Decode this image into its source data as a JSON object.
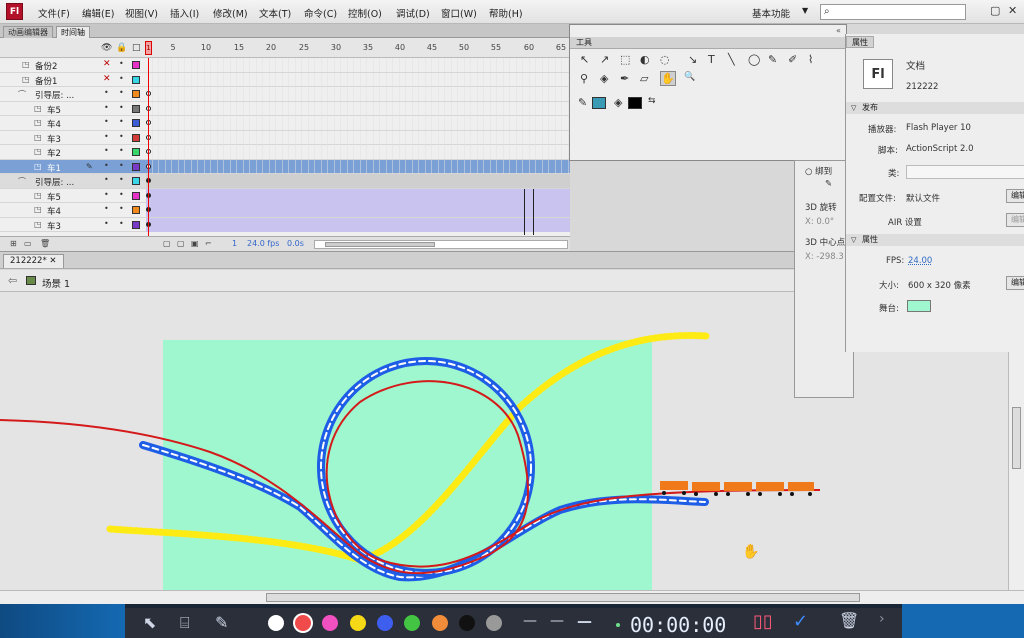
{
  "app": {
    "logo": "Fl"
  },
  "menu": [
    "文件(F)",
    "编辑(E)",
    "视图(V)",
    "插入(I)",
    "修改(M)",
    "文本(T)",
    "命令(C)",
    "控制(O)",
    "调试(D)",
    "窗口(W)",
    "帮助(H)"
  ],
  "workspace": {
    "label": "基本功能",
    "arrow": "▼"
  },
  "search": {
    "icon": "⌕",
    "placeholder": ""
  },
  "window_buttons": [
    "▢",
    "✕"
  ],
  "tabs": {
    "motion_editor": "动画编辑器",
    "timeline": "时间轴"
  },
  "timeline": {
    "frame_numbers": [
      "5",
      "10",
      "15",
      "20",
      "25",
      "30",
      "35",
      "40",
      "45",
      "50",
      "55",
      "60",
      "65"
    ],
    "playhead": "1",
    "header_icons": [
      "eye-icon",
      "lock-icon",
      "outline-icon"
    ],
    "layers": [
      {
        "name": "备份2",
        "color": "#e632c8"
      },
      {
        "name": "备份1",
        "color": "#38d6e6"
      },
      {
        "name": "引导层: ...",
        "color": "#f08a1e",
        "guide": true
      },
      {
        "name": "车5",
        "color": "#777777"
      },
      {
        "name": "车4",
        "color": "#3c5cd6"
      },
      {
        "name": "车3",
        "color": "#d43a3a"
      },
      {
        "name": "车2",
        "color": "#38d66a"
      },
      {
        "name": "车1",
        "color": "#7a3ac8",
        "selected": true
      },
      {
        "name": "引导层: ...",
        "color": "#38d6e6",
        "guide": true
      },
      {
        "name": "车5",
        "color": "#e632c8"
      },
      {
        "name": "车4",
        "color": "#f08a1e"
      },
      {
        "name": "车3",
        "color": "#7a3ac8"
      }
    ],
    "footer": {
      "fps": "24.0 fps",
      "time": "0.0s",
      "frame": "1"
    }
  },
  "document": {
    "tab": "212222*",
    "close": "✕",
    "scene": "场景 1"
  },
  "tools_panel": {
    "title": "工具",
    "tools_row1": [
      "↖",
      "↗",
      "⬚",
      "◐",
      "◌",
      "↘",
      "T",
      "╲",
      "◯",
      "✎",
      "✐",
      "⌇"
    ],
    "tools_row2": [
      "⚲",
      "◈",
      "✒",
      "▱",
      "✋",
      "🔍"
    ]
  },
  "props_under": {
    "item1": "○ 绑到",
    "item2": "3D 旋转",
    "item3": "X: 0.0°",
    "item4": "3D 中心点",
    "item5": "X: -298.3"
  },
  "properties": {
    "title": "属性",
    "doc_icon": "Fl",
    "doc_type": "文档",
    "doc_name": "212222",
    "publish_section": "发布",
    "player_label": "播放器:",
    "player_value": "Flash Player 10",
    "script_label": "脚本:",
    "script_value": "ActionScript 2.0",
    "class_label": "类:",
    "profile_label": "配置文件:",
    "profile_value": "默认文件",
    "edit_label": "编辑",
    "air_label": "AIR 设置",
    "attr_section": "属性",
    "fps_label": "FPS:",
    "fps_value": "24.00",
    "size_label": "大小:",
    "size_value": "600 x 320 像素",
    "stage_label": "舞台:",
    "stage_color": "#9ff7cf"
  },
  "recorder": {
    "timer": "00:00:00",
    "colors": [
      "#ffffff",
      "#f04a4a",
      "#f050c0",
      "#f5d816",
      "#3e5ef0",
      "#43c443",
      "#f08c3a",
      "#111111",
      "#999999"
    ]
  }
}
